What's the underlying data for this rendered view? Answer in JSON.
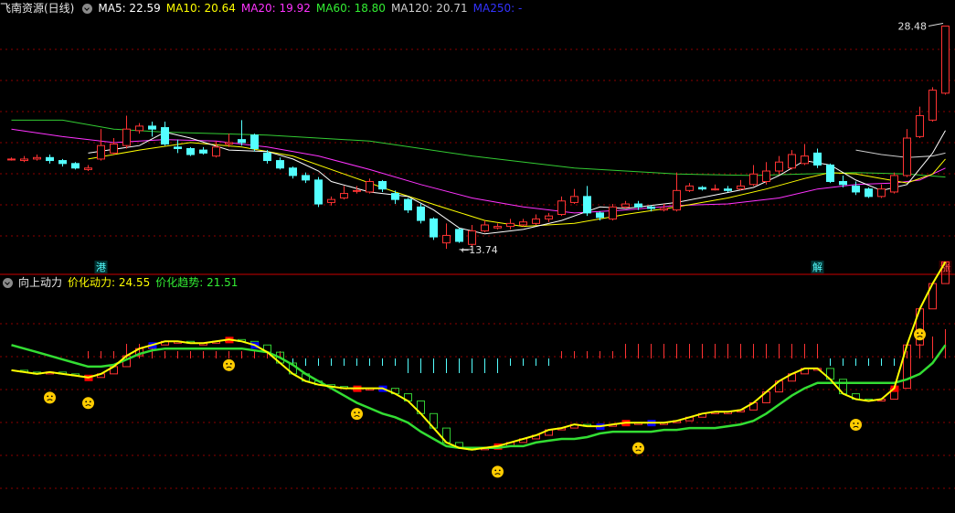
{
  "header": {
    "title": "飞南资源(日线)",
    "ma": [
      {
        "label": "MA5: 22.59",
        "color": "#ffffff"
      },
      {
        "label": "MA10: 20.64",
        "color": "#ffff00"
      },
      {
        "label": "MA20: 19.92",
        "color": "#ff33ff"
      },
      {
        "label": "MA60: 18.80",
        "color": "#33ee33"
      },
      {
        "label": "MA120: 20.71",
        "color": "#cccccc"
      },
      {
        "label": "MA250: -",
        "color": "#3333ff"
      }
    ]
  },
  "indicator": {
    "name": "向上动力",
    "items": [
      {
        "label": "价化动力: 24.55",
        "color": "#ffff00"
      },
      {
        "label": "价化趋势: 21.51",
        "color": "#33ee33"
      }
    ]
  },
  "colors": {
    "up": "#ff3333",
    "down": "#54ffff",
    "grid": "#8b0000",
    "ma5": "#ffffff",
    "ma10": "#ffff00",
    "ma20": "#ff33ff",
    "ma60": "#33cc33",
    "ma120": "#cccccc",
    "dyn": "#ffff00",
    "trend": "#33dd33",
    "face": "#ffcc00"
  },
  "chart_data": [
    {
      "type": "candlestick",
      "title": "飞南资源(日线)",
      "ylim": [
        13.0,
        29.0
      ],
      "annotations": {
        "high": "28.48",
        "low": "13.74"
      },
      "markers": [
        {
          "index": 7,
          "text": "港"
        },
        {
          "index": 63,
          "text": "解"
        },
        {
          "index": 73,
          "text": "涨"
        }
      ],
      "candles": [
        [
          19.6,
          19.6,
          19.5,
          19.7
        ],
        [
          19.5,
          19.6,
          19.4,
          19.8
        ],
        [
          19.6,
          19.7,
          19.5,
          19.9
        ],
        [
          19.7,
          19.5,
          19.3,
          19.9
        ],
        [
          19.5,
          19.3,
          19.1,
          19.6
        ],
        [
          19.3,
          19.0,
          18.9,
          19.4
        ],
        [
          18.9,
          19.0,
          18.8,
          19.2
        ],
        [
          19.6,
          20.5,
          19.5,
          21.6
        ],
        [
          20.0,
          20.6,
          19.9,
          21.0
        ],
        [
          20.5,
          21.6,
          20.3,
          22.5
        ],
        [
          21.5,
          21.8,
          21.3,
          22.0
        ],
        [
          21.8,
          21.6,
          21.1,
          22.1
        ],
        [
          21.7,
          20.6,
          20.5,
          22.1
        ],
        [
          20.4,
          20.3,
          20.0,
          20.9
        ],
        [
          20.3,
          19.9,
          19.8,
          20.4
        ],
        [
          20.2,
          20.0,
          19.9,
          20.4
        ],
        [
          19.8,
          20.4,
          19.7,
          20.8
        ],
        [
          20.6,
          20.7,
          20.4,
          21.3
        ],
        [
          20.9,
          20.7,
          20.5,
          22.2
        ],
        [
          21.2,
          20.3,
          20.1,
          21.3
        ],
        [
          20.0,
          19.5,
          19.3,
          20.2
        ],
        [
          19.5,
          19.0,
          18.9,
          19.7
        ],
        [
          19.0,
          18.5,
          18.3,
          19.1
        ],
        [
          18.5,
          18.2,
          18.0,
          18.7
        ],
        [
          18.2,
          16.6,
          16.4,
          18.4
        ],
        [
          16.7,
          16.9,
          16.5,
          17.1
        ],
        [
          17.0,
          17.3,
          16.9,
          17.8
        ],
        [
          17.5,
          17.5,
          17.3,
          17.8
        ],
        [
          17.4,
          18.1,
          17.3,
          18.3
        ],
        [
          18.1,
          17.6,
          17.4,
          18.2
        ],
        [
          17.3,
          16.9,
          16.6,
          17.5
        ],
        [
          16.9,
          16.2,
          16.0,
          17.0
        ],
        [
          16.4,
          15.5,
          15.3,
          16.6
        ],
        [
          15.6,
          14.4,
          14.2,
          15.7
        ],
        [
          14.0,
          14.5,
          13.6,
          15.3
        ],
        [
          14.9,
          14.1,
          14.0,
          15.0
        ],
        [
          13.9,
          14.8,
          13.74,
          15.2
        ],
        [
          14.8,
          15.2,
          14.7,
          15.5
        ],
        [
          15.0,
          15.1,
          14.9,
          15.3
        ],
        [
          15.1,
          15.3,
          14.9,
          15.6
        ],
        [
          15.2,
          15.4,
          15.1,
          15.6
        ],
        [
          15.3,
          15.6,
          15.2,
          15.9
        ],
        [
          15.6,
          15.8,
          15.4,
          16.0
        ],
        [
          15.9,
          16.8,
          15.8,
          17.1
        ],
        [
          16.7,
          17.1,
          16.6,
          17.6
        ],
        [
          17.1,
          16.0,
          15.8,
          17.8
        ],
        [
          16.0,
          15.7,
          15.5,
          16.1
        ],
        [
          15.6,
          16.4,
          15.5,
          16.6
        ],
        [
          16.4,
          16.6,
          16.3,
          16.8
        ],
        [
          16.6,
          16.4,
          16.2,
          16.8
        ],
        [
          16.4,
          16.3,
          16.1,
          16.5
        ],
        [
          16.2,
          16.3,
          16.1,
          16.6
        ],
        [
          16.2,
          17.5,
          16.1,
          18.7
        ],
        [
          17.5,
          17.8,
          17.4,
          18.0
        ],
        [
          17.7,
          17.6,
          17.5,
          17.8
        ],
        [
          17.6,
          17.6,
          17.5,
          17.9
        ],
        [
          17.6,
          17.5,
          17.4,
          17.8
        ],
        [
          17.6,
          17.8,
          17.5,
          18.2
        ],
        [
          17.9,
          18.6,
          17.8,
          19.2
        ],
        [
          18.1,
          18.8,
          17.9,
          19.4
        ],
        [
          18.8,
          19.4,
          18.6,
          19.8
        ],
        [
          19.0,
          19.9,
          18.9,
          20.2
        ],
        [
          19.3,
          19.8,
          19.2,
          20.6
        ],
        [
          20.0,
          19.2,
          19.0,
          20.3
        ],
        [
          19.2,
          18.1,
          18.0,
          19.3
        ],
        [
          18.1,
          17.9,
          17.7,
          18.5
        ],
        [
          17.8,
          17.4,
          17.2,
          18.1
        ],
        [
          17.6,
          17.1,
          17.0,
          17.7
        ],
        [
          17.1,
          17.6,
          17.0,
          17.9
        ],
        [
          17.4,
          18.5,
          17.3,
          18.7
        ],
        [
          18.5,
          21.0,
          18.4,
          21.6
        ],
        [
          21.1,
          22.5,
          21.0,
          23.1
        ],
        [
          22.2,
          24.2,
          22.1,
          24.4
        ],
        [
          24.0,
          28.48,
          23.9,
          28.48
        ]
      ],
      "ma": {
        "ma5": [
          [
            6,
            20.0
          ],
          [
            10,
            20.5
          ],
          [
            12,
            21.4
          ],
          [
            14,
            21.0
          ],
          [
            17,
            20.2
          ],
          [
            20,
            20.1
          ],
          [
            22,
            19.6
          ],
          [
            24,
            18.8
          ],
          [
            25,
            18.1
          ],
          [
            28,
            17.4
          ],
          [
            31,
            17.1
          ],
          [
            33,
            16.2
          ],
          [
            35,
            15.0
          ],
          [
            37,
            14.6
          ],
          [
            40,
            14.9
          ],
          [
            43,
            15.5
          ],
          [
            46,
            16.4
          ],
          [
            48,
            16.3
          ],
          [
            52,
            16.7
          ],
          [
            55,
            17.2
          ],
          [
            58,
            17.7
          ],
          [
            60,
            18.5
          ],
          [
            62,
            19.5
          ],
          [
            64,
            19.2
          ],
          [
            66,
            18.2
          ],
          [
            68,
            17.5
          ],
          [
            70,
            17.9
          ],
          [
            72,
            20.0
          ],
          [
            73,
            21.5
          ]
        ],
        "ma10": [
          [
            6,
            19.6
          ],
          [
            10,
            20.2
          ],
          [
            14,
            20.7
          ],
          [
            18,
            20.4
          ],
          [
            22,
            19.8
          ],
          [
            26,
            18.6
          ],
          [
            30,
            17.4
          ],
          [
            34,
            16.3
          ],
          [
            37,
            15.5
          ],
          [
            40,
            15.1
          ],
          [
            44,
            15.3
          ],
          [
            48,
            15.9
          ],
          [
            52,
            16.4
          ],
          [
            56,
            17.0
          ],
          [
            59,
            17.6
          ],
          [
            62,
            18.3
          ],
          [
            64,
            18.7
          ],
          [
            66,
            18.6
          ],
          [
            68,
            18.3
          ],
          [
            70,
            18.0
          ],
          [
            72,
            18.6
          ],
          [
            73,
            19.6
          ]
        ],
        "ma20": [
          [
            0,
            21.6
          ],
          [
            4,
            21.1
          ],
          [
            8,
            20.7
          ],
          [
            12,
            20.9
          ],
          [
            16,
            20.8
          ],
          [
            20,
            20.4
          ],
          [
            24,
            19.8
          ],
          [
            28,
            18.9
          ],
          [
            32,
            17.9
          ],
          [
            36,
            17.0
          ],
          [
            40,
            16.4
          ],
          [
            44,
            16.0
          ],
          [
            48,
            16.2
          ],
          [
            52,
            16.5
          ],
          [
            56,
            16.6
          ],
          [
            60,
            17.0
          ],
          [
            63,
            17.6
          ],
          [
            66,
            17.9
          ],
          [
            69,
            18.0
          ],
          [
            71,
            18.2
          ],
          [
            73,
            19.0
          ]
        ],
        "ma60": [
          [
            0,
            22.2
          ],
          [
            4,
            22.2
          ],
          [
            8,
            21.6
          ],
          [
            12,
            21.4
          ],
          [
            20,
            21.2
          ],
          [
            28,
            20.8
          ],
          [
            36,
            19.8
          ],
          [
            44,
            19.0
          ],
          [
            52,
            18.6
          ],
          [
            58,
            18.5
          ],
          [
            62,
            18.6
          ],
          [
            66,
            18.7
          ],
          [
            70,
            18.6
          ],
          [
            73,
            18.4
          ]
        ],
        "ma120": [
          [
            66,
            20.2
          ],
          [
            68,
            19.9
          ],
          [
            70,
            19.7
          ],
          [
            72,
            19.8
          ],
          [
            73,
            20.0
          ]
        ]
      }
    },
    {
      "type": "indicator",
      "title": "向上动力",
      "ylim": [
        0,
        60
      ],
      "series": [
        {
          "name": "价化动力",
          "values": [
            38,
            37.5,
            37,
            37.5,
            37,
            36.5,
            36,
            37,
            39,
            42,
            44,
            45,
            46,
            46,
            45.5,
            45.5,
            46,
            46.5,
            46,
            45,
            43,
            40,
            37,
            35,
            34,
            33.5,
            33,
            33,
            33,
            33,
            31.5,
            29.5,
            26,
            22,
            18,
            16.5,
            16,
            16.5,
            17,
            18,
            19,
            20,
            21.5,
            22,
            23,
            22.5,
            22.5,
            23,
            23.5,
            23.5,
            23.5,
            23.5,
            24,
            25,
            26,
            26.5,
            26.5,
            27,
            29,
            32,
            35,
            37,
            38.5,
            38.5,
            35.5,
            31.5,
            30,
            29.5,
            30,
            33,
            45,
            55,
            62,
            68
          ]
        },
        {
          "name": "价化趋势",
          "values": [
            45,
            44,
            43,
            42,
            41,
            40,
            39,
            39,
            39.5,
            41,
            42.5,
            43.5,
            44,
            44,
            44,
            44,
            44,
            44,
            44,
            43.5,
            43,
            41.5,
            39.5,
            37,
            35,
            33,
            31,
            29,
            27.5,
            26,
            25,
            23.5,
            21,
            19,
            17,
            16.5,
            16.5,
            16.5,
            16.5,
            17,
            17,
            18,
            18.5,
            19,
            19,
            19.5,
            20.5,
            21,
            21,
            21,
            21,
            21.5,
            21.5,
            22,
            22,
            22,
            22.5,
            23,
            24,
            26,
            28.5,
            31,
            33,
            34.5,
            34.5,
            34.5,
            34.5,
            34.5,
            34.5,
            34.5,
            35.5,
            37,
            40,
            45
          ]
        }
      ],
      "bars": [
        0,
        0,
        0,
        0,
        0,
        0,
        1,
        1,
        1,
        2,
        2,
        2,
        1,
        1,
        1,
        1,
        1,
        1,
        1,
        1,
        1,
        1,
        -1,
        -1,
        -1,
        -1,
        -1,
        -1,
        -1,
        -1,
        -1,
        -2,
        -2,
        -2,
        -2,
        -2,
        -2,
        -2,
        -2,
        -1,
        -1,
        -1,
        -1,
        1,
        1,
        1,
        1,
        1,
        2,
        2,
        2,
        2,
        2,
        2,
        2,
        2,
        2,
        2,
        2,
        2,
        2,
        2,
        2,
        2,
        -1,
        -1,
        -1,
        -1,
        -1,
        -1,
        1,
        2,
        3,
        4
      ],
      "faces": [
        3,
        6,
        17,
        27,
        38,
        49,
        66,
        71
      ]
    }
  ]
}
